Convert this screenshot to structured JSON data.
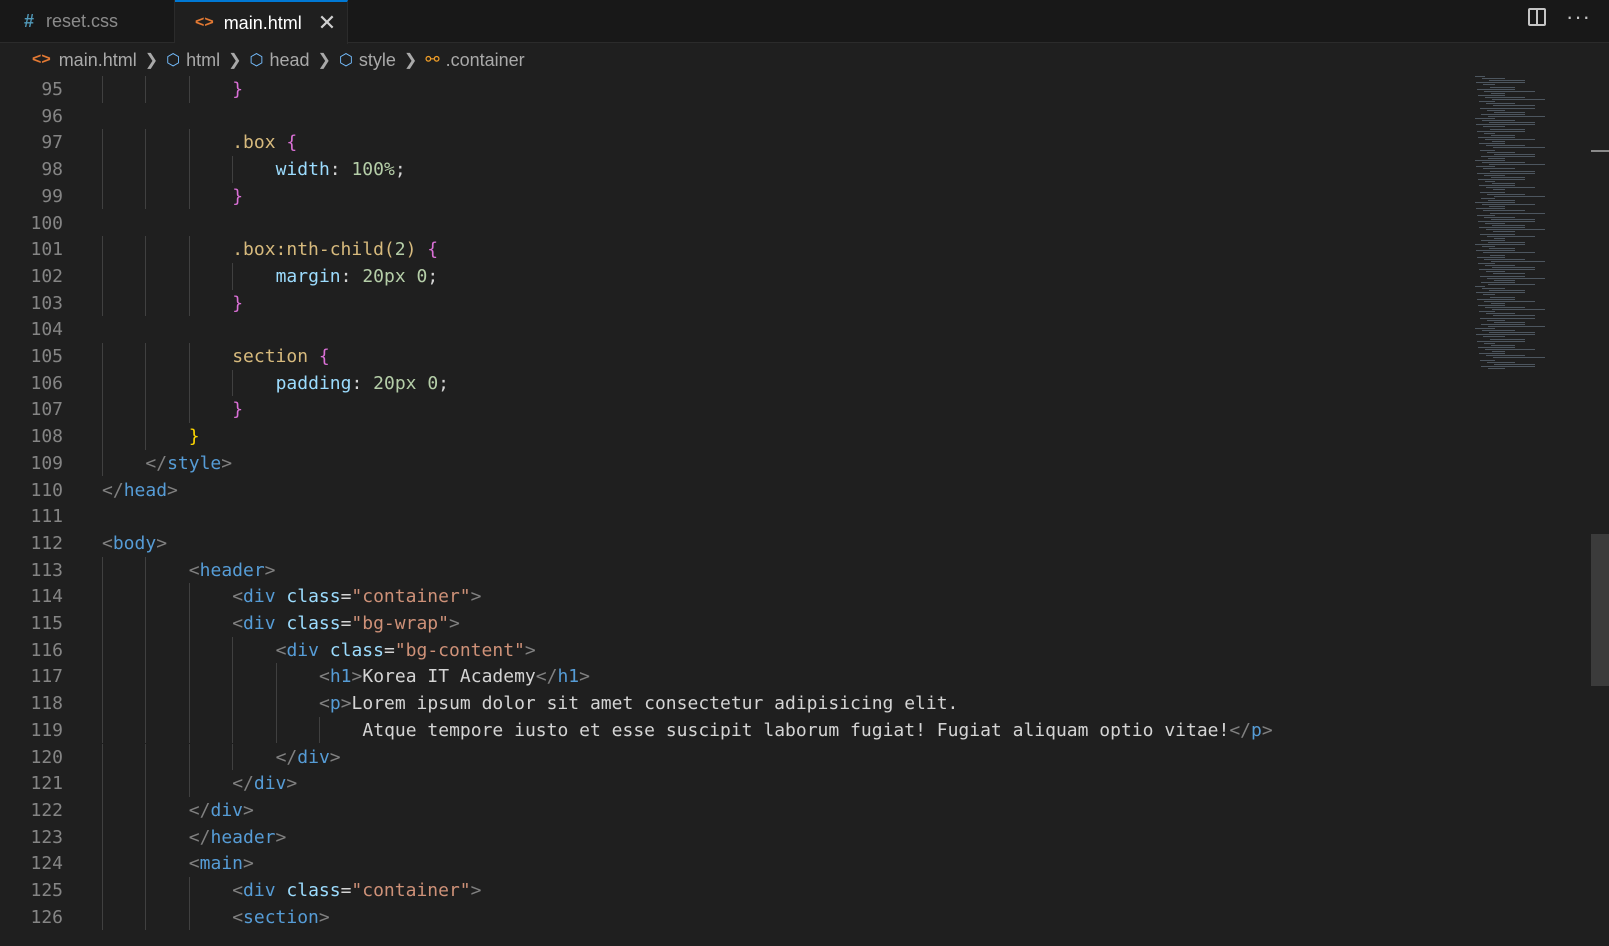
{
  "tabs": [
    {
      "label": "reset.css",
      "icon": "hash-icon",
      "active": false
    },
    {
      "label": "main.html",
      "icon": "html-icon",
      "active": true
    }
  ],
  "breadcrumb": [
    "main.html",
    "html",
    "head",
    "style",
    ".container"
  ],
  "code_lines": [
    {
      "n": "95",
      "tokens": [
        [
          "}",
          "br1"
        ]
      ]
    },
    {
      "n": "96",
      "tokens": []
    },
    {
      "n": "97",
      "tokens": [
        [
          ".box ",
          "sel"
        ],
        [
          "{",
          "br1"
        ]
      ]
    },
    {
      "n": "98",
      "tokens": [
        [
          "width",
          "prop"
        ],
        [
          ": ",
          "txt"
        ],
        [
          "100%",
          "num"
        ],
        [
          ";",
          "txt"
        ]
      ]
    },
    {
      "n": "99",
      "tokens": [
        [
          "}",
          "br1"
        ]
      ]
    },
    {
      "n": "100",
      "tokens": []
    },
    {
      "n": "101",
      "tokens": [
        [
          ".box:nth-child(",
          "sel"
        ],
        [
          "2",
          "num"
        ],
        [
          ") ",
          "sel"
        ],
        [
          "{",
          "br1"
        ]
      ]
    },
    {
      "n": "102",
      "tokens": [
        [
          "margin",
          "prop"
        ],
        [
          ": ",
          "txt"
        ],
        [
          "20px 0",
          "num"
        ],
        [
          ";",
          "txt"
        ]
      ]
    },
    {
      "n": "103",
      "tokens": [
        [
          "}",
          "br1"
        ]
      ]
    },
    {
      "n": "104",
      "tokens": []
    },
    {
      "n": "105",
      "tokens": [
        [
          "section ",
          "sel"
        ],
        [
          "{",
          "br1"
        ]
      ]
    },
    {
      "n": "106",
      "tokens": [
        [
          "padding",
          "prop"
        ],
        [
          ": ",
          "txt"
        ],
        [
          "20px 0",
          "num"
        ],
        [
          ";",
          "txt"
        ]
      ]
    },
    {
      "n": "107",
      "tokens": [
        [
          "}",
          "br1"
        ]
      ]
    },
    {
      "n": "108",
      "tokens": [
        [
          "}",
          "br2"
        ]
      ]
    },
    {
      "n": "109",
      "tokens": [
        [
          "</",
          "tagp"
        ],
        [
          "style",
          "tag"
        ],
        [
          ">",
          "tagp"
        ]
      ]
    },
    {
      "n": "110",
      "tokens": [
        [
          "</",
          "tagp"
        ],
        [
          "head",
          "tag"
        ],
        [
          ">",
          "tagp"
        ]
      ]
    },
    {
      "n": "111",
      "tokens": []
    },
    {
      "n": "112",
      "tokens": [
        [
          "<",
          "tagp"
        ],
        [
          "body",
          "tag"
        ],
        [
          ">",
          "tagp"
        ]
      ]
    },
    {
      "n": "113",
      "tokens": [
        [
          "<",
          "tagp"
        ],
        [
          "header",
          "tag"
        ],
        [
          ">",
          "tagp"
        ]
      ]
    },
    {
      "n": "114",
      "tokens": [
        [
          "<",
          "tagp"
        ],
        [
          "div ",
          "tag"
        ],
        [
          "class",
          "attr"
        ],
        [
          "=",
          "txt"
        ],
        [
          "\"container\"",
          "str"
        ],
        [
          ">",
          "tagp"
        ]
      ]
    },
    {
      "n": "115",
      "tokens": [
        [
          "<",
          "tagp"
        ],
        [
          "div ",
          "tag"
        ],
        [
          "class",
          "attr"
        ],
        [
          "=",
          "txt"
        ],
        [
          "\"bg-wrap\"",
          "str"
        ],
        [
          ">",
          "tagp"
        ]
      ]
    },
    {
      "n": "116",
      "tokens": [
        [
          "<",
          "tagp"
        ],
        [
          "div ",
          "tag"
        ],
        [
          "class",
          "attr"
        ],
        [
          "=",
          "txt"
        ],
        [
          "\"bg-content\"",
          "str"
        ],
        [
          ">",
          "tagp"
        ]
      ]
    },
    {
      "n": "117",
      "tokens": [
        [
          "<",
          "tagp"
        ],
        [
          "h1",
          "tag"
        ],
        [
          ">",
          "tagp"
        ],
        [
          "Korea IT Academy",
          "txt"
        ],
        [
          "</",
          "tagp"
        ],
        [
          "h1",
          "tag"
        ],
        [
          ">",
          "tagp"
        ]
      ]
    },
    {
      "n": "118",
      "tokens": [
        [
          "<",
          "tagp"
        ],
        [
          "p",
          "tag"
        ],
        [
          ">",
          "tagp"
        ],
        [
          "Lorem ipsum dolor sit amet consectetur adipisicing elit.",
          "txt"
        ]
      ]
    },
    {
      "n": "119",
      "tokens": [
        [
          "Atque tempore iusto et esse suscipit laborum fugiat! Fugiat aliquam optio vitae!",
          "txt"
        ],
        [
          "</",
          "tagp"
        ],
        [
          "p",
          "tag"
        ],
        [
          ">",
          "tagp"
        ]
      ]
    },
    {
      "n": "120",
      "tokens": [
        [
          "</",
          "tagp"
        ],
        [
          "div",
          "tag"
        ],
        [
          ">",
          "tagp"
        ]
      ]
    },
    {
      "n": "121",
      "tokens": [
        [
          "</",
          "tagp"
        ],
        [
          "div",
          "tag"
        ],
        [
          ">",
          "tagp"
        ]
      ]
    },
    {
      "n": "122",
      "tokens": [
        [
          "</",
          "tagp"
        ],
        [
          "div",
          "tag"
        ],
        [
          ">",
          "tagp"
        ]
      ]
    },
    {
      "n": "123",
      "tokens": [
        [
          "</",
          "tagp"
        ],
        [
          "header",
          "tag"
        ],
        [
          ">",
          "tagp"
        ]
      ]
    },
    {
      "n": "124",
      "tokens": [
        [
          "<",
          "tagp"
        ],
        [
          "main",
          "tag"
        ],
        [
          ">",
          "tagp"
        ]
      ]
    },
    {
      "n": "125",
      "tokens": [
        [
          "<",
          "tagp"
        ],
        [
          "div ",
          "tag"
        ],
        [
          "class",
          "attr"
        ],
        [
          "=",
          "txt"
        ],
        [
          "\"container\"",
          "str"
        ],
        [
          ">",
          "tagp"
        ]
      ]
    },
    {
      "n": "126",
      "tokens": [
        [
          "<",
          "tagp"
        ],
        [
          "section",
          "tag"
        ],
        [
          ">",
          "tagp"
        ]
      ]
    }
  ]
}
